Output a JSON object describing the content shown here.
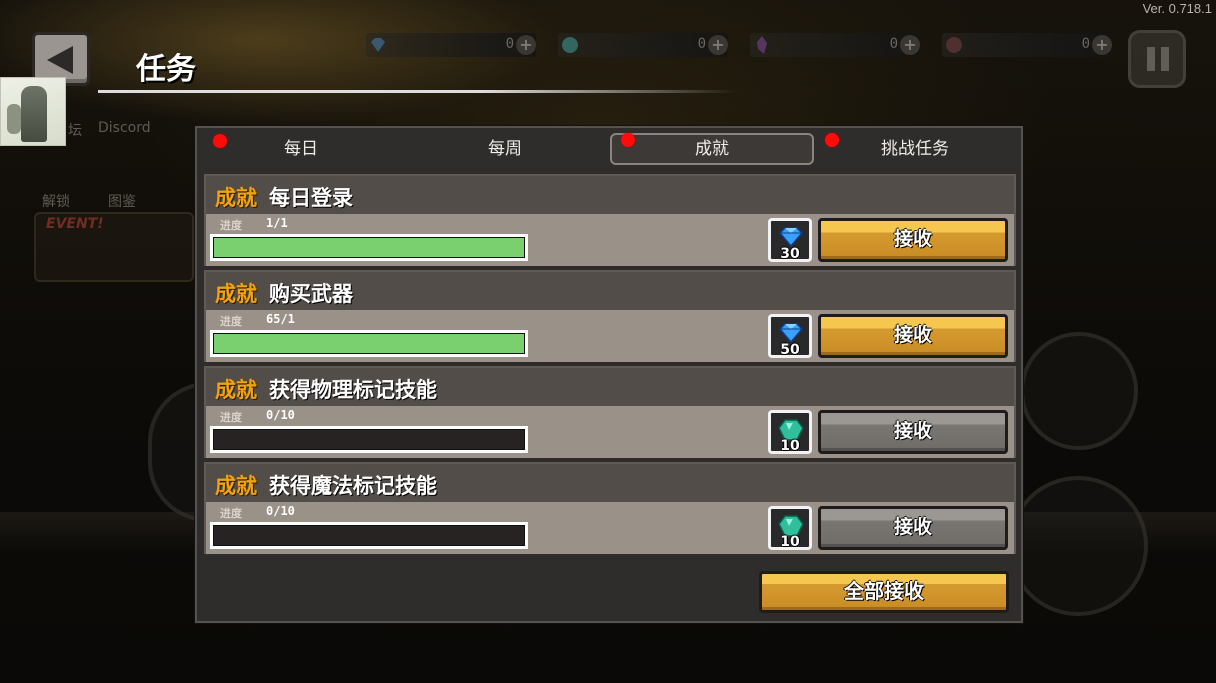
{
  "version": "Ver. 0.718.1",
  "header": {
    "title": "任务"
  },
  "currencies": [
    {
      "icon": "blue-gem-icon",
      "value": "0"
    },
    {
      "icon": "green-orb-icon",
      "value": "0"
    },
    {
      "icon": "purple-crystal-icon",
      "value": "0"
    },
    {
      "icon": "dark-orb-icon",
      "value": "0"
    }
  ],
  "side_menu": {
    "discord": "Discord",
    "forum_partial": "坛",
    "unlock": "解锁",
    "codex": "图鉴",
    "event": "EVENT!"
  },
  "tabs": [
    {
      "label": "每日",
      "badge": true,
      "active": false
    },
    {
      "label": "每周",
      "badge": false,
      "active": false
    },
    {
      "label": "成就",
      "badge": true,
      "active": true
    },
    {
      "label": "挑战任务",
      "badge": true,
      "active": false
    }
  ],
  "tasks": [
    {
      "tag": "成就",
      "name": "每日登录",
      "progress_label": "进度",
      "progress_text": "1/1",
      "progress": 1.0,
      "reward_icon": "blue-gem-icon",
      "reward_count": "30",
      "button": "接收",
      "claimable": true
    },
    {
      "tag": "成就",
      "name": "购买武器",
      "progress_label": "进度",
      "progress_text": "65/1",
      "progress": 1.0,
      "reward_icon": "blue-gem-icon",
      "reward_count": "50",
      "button": "接收",
      "claimable": true
    },
    {
      "tag": "成就",
      "name": "获得物理标记技能",
      "progress_label": "进度",
      "progress_text": "0/10",
      "progress": 0.0,
      "reward_icon": "green-orb-icon",
      "reward_count": "10",
      "button": "接收",
      "claimable": false
    },
    {
      "tag": "成就",
      "name": "获得魔法标记技能",
      "progress_label": "进度",
      "progress_text": "0/10",
      "progress": 0.0,
      "reward_icon": "green-orb-icon",
      "reward_count": "10",
      "button": "接收",
      "claimable": false
    }
  ],
  "claim_all": "全部接收",
  "colors": {
    "accent_orange": "#f4a20d",
    "progress_green": "#7acf6e",
    "badge_red": "#ff0b0b",
    "button_gold": "#f6c74f"
  }
}
